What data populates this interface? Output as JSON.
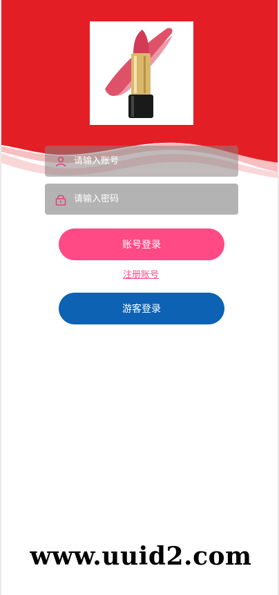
{
  "login": {
    "account_placeholder": "请输入账号",
    "password_placeholder": "请输入密码",
    "login_button": "账号登录",
    "register_link": "注册账号",
    "guest_button": "游客登录"
  },
  "watermark": "www.uuid2.com",
  "icons": {
    "account": "user-icon",
    "password": "lock-icon",
    "product": "lipstick-product-image"
  },
  "colors": {
    "header_red": "#e41e25",
    "login_pink": "#ff4a86",
    "guest_blue": "#0d62b3",
    "icon_pink": "#e5417a"
  }
}
